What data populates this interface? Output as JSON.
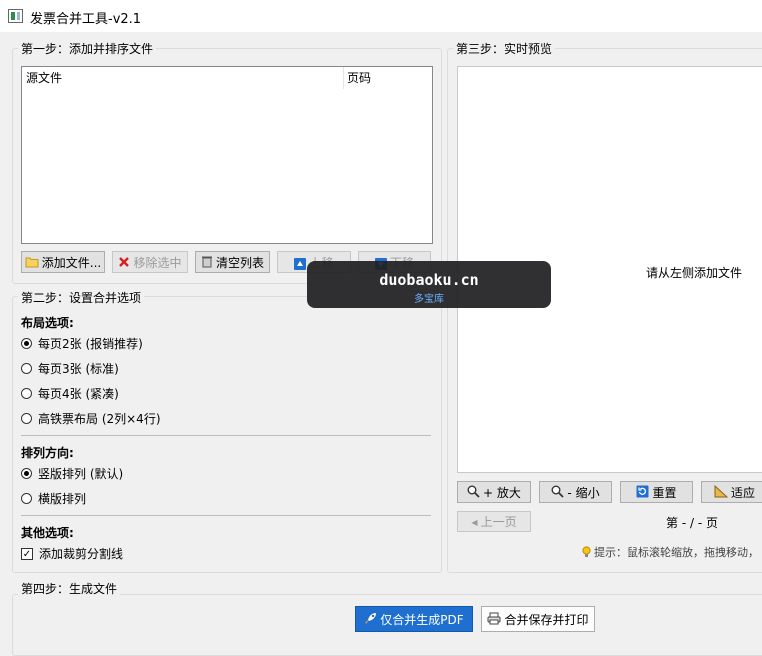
{
  "window": {
    "title": "发票合并工具-v2.1"
  },
  "step1": {
    "title": "第一步：添加并排序文件",
    "columns": [
      "源文件",
      "页码"
    ],
    "buttons": {
      "add": "添加文件...",
      "remove": "移除选中",
      "clear": "清空列表",
      "up": "上移",
      "down": "下移"
    }
  },
  "step2": {
    "title": "第二步：设置合并选项",
    "layout_label": "布局选项:",
    "layout_options": [
      "每页2张 (报销推荐)",
      "每页3张 (标准)",
      "每页4张 (紧凑)",
      "高铁票布局 (2列×4行)"
    ],
    "layout_selected": 0,
    "direction_label": "排列方向:",
    "direction_options": [
      "竖版排列 (默认)",
      "横版排列"
    ],
    "direction_selected": 0,
    "other_label": "其他选项:",
    "cut_line_label": "添加裁剪分割线",
    "cut_line_checked": true
  },
  "step3": {
    "title": "第三步：实时预览",
    "empty_text": "请从左侧添加文件",
    "buttons": {
      "zoom_in": "放大",
      "zoom_out": "缩小",
      "reset": "重置",
      "fit": "适应",
      "prev": "上一页"
    },
    "page_indicator": "第 - / - 页",
    "hint": "提示：鼠标滚轮缩放，拖拽移动，"
  },
  "step4": {
    "title": "第四步：生成文件",
    "merge_pdf": "仅合并生成PDF",
    "merge_print": "合并保存并打印"
  },
  "watermark": {
    "domain": "duobaoku.cn",
    "name": "多宝库"
  },
  "colors": {
    "accent": "#1e6fd0",
    "window_bg": "#f0f0f0"
  }
}
